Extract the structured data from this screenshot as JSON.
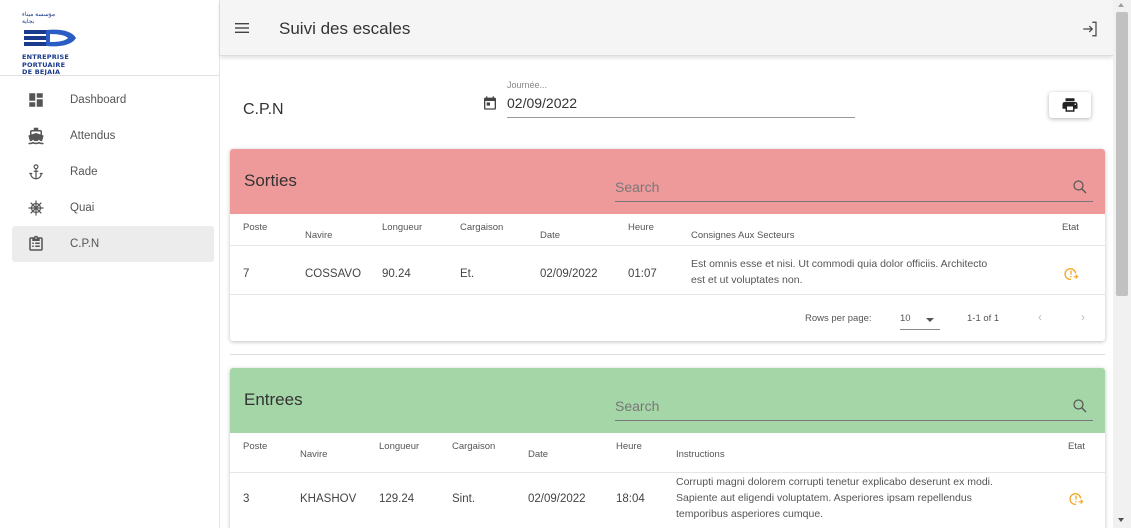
{
  "logo": {
    "arabic_text": "مؤسسة ميناء بجاية",
    "line1": "ENTREPRISE",
    "line2": "PORTUAIRE",
    "line3": "DE BEJAIA"
  },
  "sidebar": {
    "items": [
      {
        "label": "Dashboard",
        "icon": "dashboard-icon"
      },
      {
        "label": "Attendus",
        "icon": "ship-icon"
      },
      {
        "label": "Rade",
        "icon": "anchor-icon"
      },
      {
        "label": "Quai",
        "icon": "helm-icon"
      },
      {
        "label": "C.P.N",
        "icon": "clipboard-icon",
        "active": true
      }
    ]
  },
  "header": {
    "title": "Suivi des escales"
  },
  "page": {
    "title": "C.P.N",
    "date_label": "Journée...",
    "date_value": "02/09/2022"
  },
  "sorties": {
    "title": "Sorties",
    "color": "#ef9a9a",
    "search_placeholder": "Search",
    "columns": [
      "Poste",
      "Navire",
      "Longueur",
      "Cargaison",
      "Date",
      "Heure",
      "Consignes Aux Secteurs",
      "Etat"
    ],
    "rows": [
      {
        "poste": "7",
        "navire": "COSSAVO",
        "longueur": "90.24",
        "cargaison": "Et.",
        "date": "02/09/2022",
        "heure": "01:07",
        "consignes_line1": "Est omnis esse et nisi. Ut commodi quia dolor officiis. Architecto",
        "consignes_line2": "est et ut voluptates non.",
        "etat_icon": "clock-alert-icon"
      }
    ],
    "pagination": {
      "rows_per_page_label": "Rows per page:",
      "rows_per_page": "10",
      "range": "1-1 of 1"
    }
  },
  "entrees": {
    "title": "Entrees",
    "color": "#a5d6a7",
    "search_placeholder": "Search",
    "columns": [
      "Poste",
      "Navire",
      "Longueur",
      "Cargaison",
      "Date",
      "Heure",
      "Instructions",
      "Etat"
    ],
    "rows": [
      {
        "poste": "3",
        "navire": "KHASHOV",
        "longueur": "129.24",
        "cargaison": "Sint.",
        "date": "02/09/2022",
        "heure": "18:04",
        "instructions_line1": "Corrupti magni dolorem corrupti tenetur explicabo deserunt ex modi.",
        "instructions_line2": "Sapiente aut eligendi voluptatem. Asperiores ipsam repellendus",
        "instructions_line3": "temporibus asperiores cumque.",
        "etat_icon": "clock-alert-icon"
      }
    ]
  },
  "colors": {
    "accent_status": "#f5a623"
  }
}
